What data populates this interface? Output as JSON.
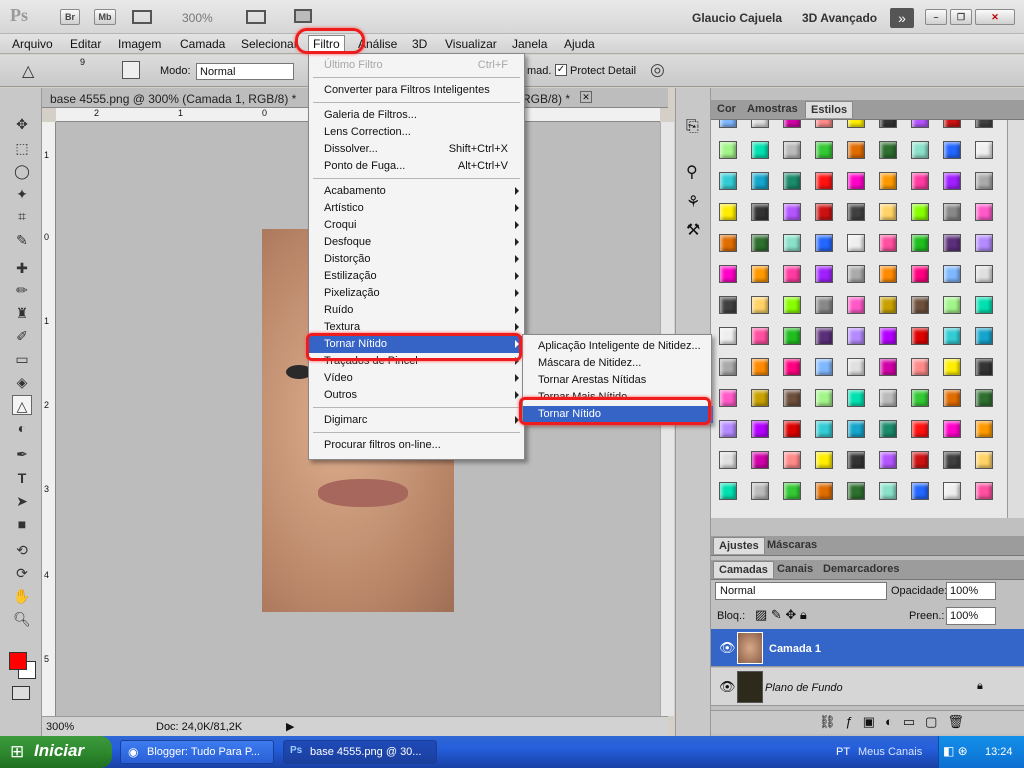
{
  "appbar": {
    "logo": "Ps",
    "br": "Br",
    "mb": "Mb",
    "zoom": "300%",
    "user": "Glaucio Cajuela",
    "workspace": "3D Avançado"
  },
  "menubar": [
    "Arquivo",
    "Editar",
    "Imagem",
    "Camada",
    "Selecionar",
    "Filtro",
    "Análise",
    "3D",
    "Visualizar",
    "Janela",
    "Ajuda"
  ],
  "options": {
    "size": "9",
    "mode_label": "Modo:",
    "mode_value": "Normal",
    "amount_label": "mad.",
    "protect_detail": "Protect Detail"
  },
  "document": {
    "tab_title": "base 4555.png @ 300% (Camada 1, RGB/8) *",
    "tab_title_right": "RGB/8) *",
    "zoom": "300%",
    "doc_info": "Doc: 24,0K/81,2K",
    "ruler_top": [
      "2",
      "1",
      "0",
      "1"
    ],
    "ruler_left": [
      "1",
      "0",
      "1",
      "2",
      "3",
      "4",
      "5"
    ]
  },
  "filter_menu": [
    {
      "label": "Último Filtro",
      "shortcut": "Ctrl+F",
      "disabled": true
    },
    {
      "sep": true
    },
    {
      "label": "Converter para Filtros Inteligentes"
    },
    {
      "sep": true
    },
    {
      "label": "Galeria de Filtros..."
    },
    {
      "label": "Lens Correction..."
    },
    {
      "label": "Dissolver...",
      "shortcut": "Shift+Ctrl+X"
    },
    {
      "label": "Ponto de Fuga...",
      "shortcut": "Alt+Ctrl+V"
    },
    {
      "sep": true
    },
    {
      "label": "Acabamento",
      "sub": true
    },
    {
      "label": "Artístico",
      "sub": true
    },
    {
      "label": "Croqui",
      "sub": true
    },
    {
      "label": "Desfoque",
      "sub": true
    },
    {
      "label": "Distorção",
      "sub": true
    },
    {
      "label": "Estilização",
      "sub": true
    },
    {
      "label": "Pixelização",
      "sub": true
    },
    {
      "label": "Ruído",
      "sub": true
    },
    {
      "label": "Textura",
      "sub": true
    },
    {
      "label": "Tornar Nítido",
      "sub": true,
      "highlight": true
    },
    {
      "label": "Traçados de Pincel",
      "sub": true
    },
    {
      "label": "Vídeo",
      "sub": true
    },
    {
      "label": "Outros",
      "sub": true
    },
    {
      "sep": true
    },
    {
      "label": "Digimarc",
      "sub": true
    },
    {
      "sep": true
    },
    {
      "label": "Procurar filtros on-line..."
    }
  ],
  "sharpen_submenu": [
    {
      "label": "Aplicação Inteligente de Nitidez..."
    },
    {
      "label": "Máscara de Nitidez..."
    },
    {
      "label": "Tornar Arestas Nítidas"
    },
    {
      "label": "Tornar Mais Nítido"
    },
    {
      "label": "Tornar Nítido",
      "highlight": true
    }
  ],
  "styles_panel": {
    "tabs": [
      "Cor",
      "Amostras",
      "Estilos"
    ]
  },
  "adjust_panel": {
    "tabs": [
      "Ajustes",
      "Máscaras"
    ]
  },
  "layers_panel": {
    "tabs": [
      "Camadas",
      "Canais",
      "Demarcadores"
    ],
    "blend": "Normal",
    "opacity_label": "Opacidade:",
    "opacity": "100%",
    "lock_label": "Bloq.:",
    "fill_label": "Preen.:",
    "fill": "100%",
    "layers": [
      {
        "name": "Camada 1",
        "selected": true
      },
      {
        "name": "Plano de Fundo",
        "selected": false
      }
    ]
  },
  "taskbar": {
    "start": "Iniciar",
    "tasks": [
      "Blogger: Tudo Para P...",
      "base 4555.png @ 30..."
    ],
    "lang": "PT",
    "canais": "Meus Canais",
    "time": "13:24"
  },
  "colors": {
    "highlight": "#3563c6",
    "foreground": "#ff0000",
    "annotation": "#ee1c1c"
  }
}
